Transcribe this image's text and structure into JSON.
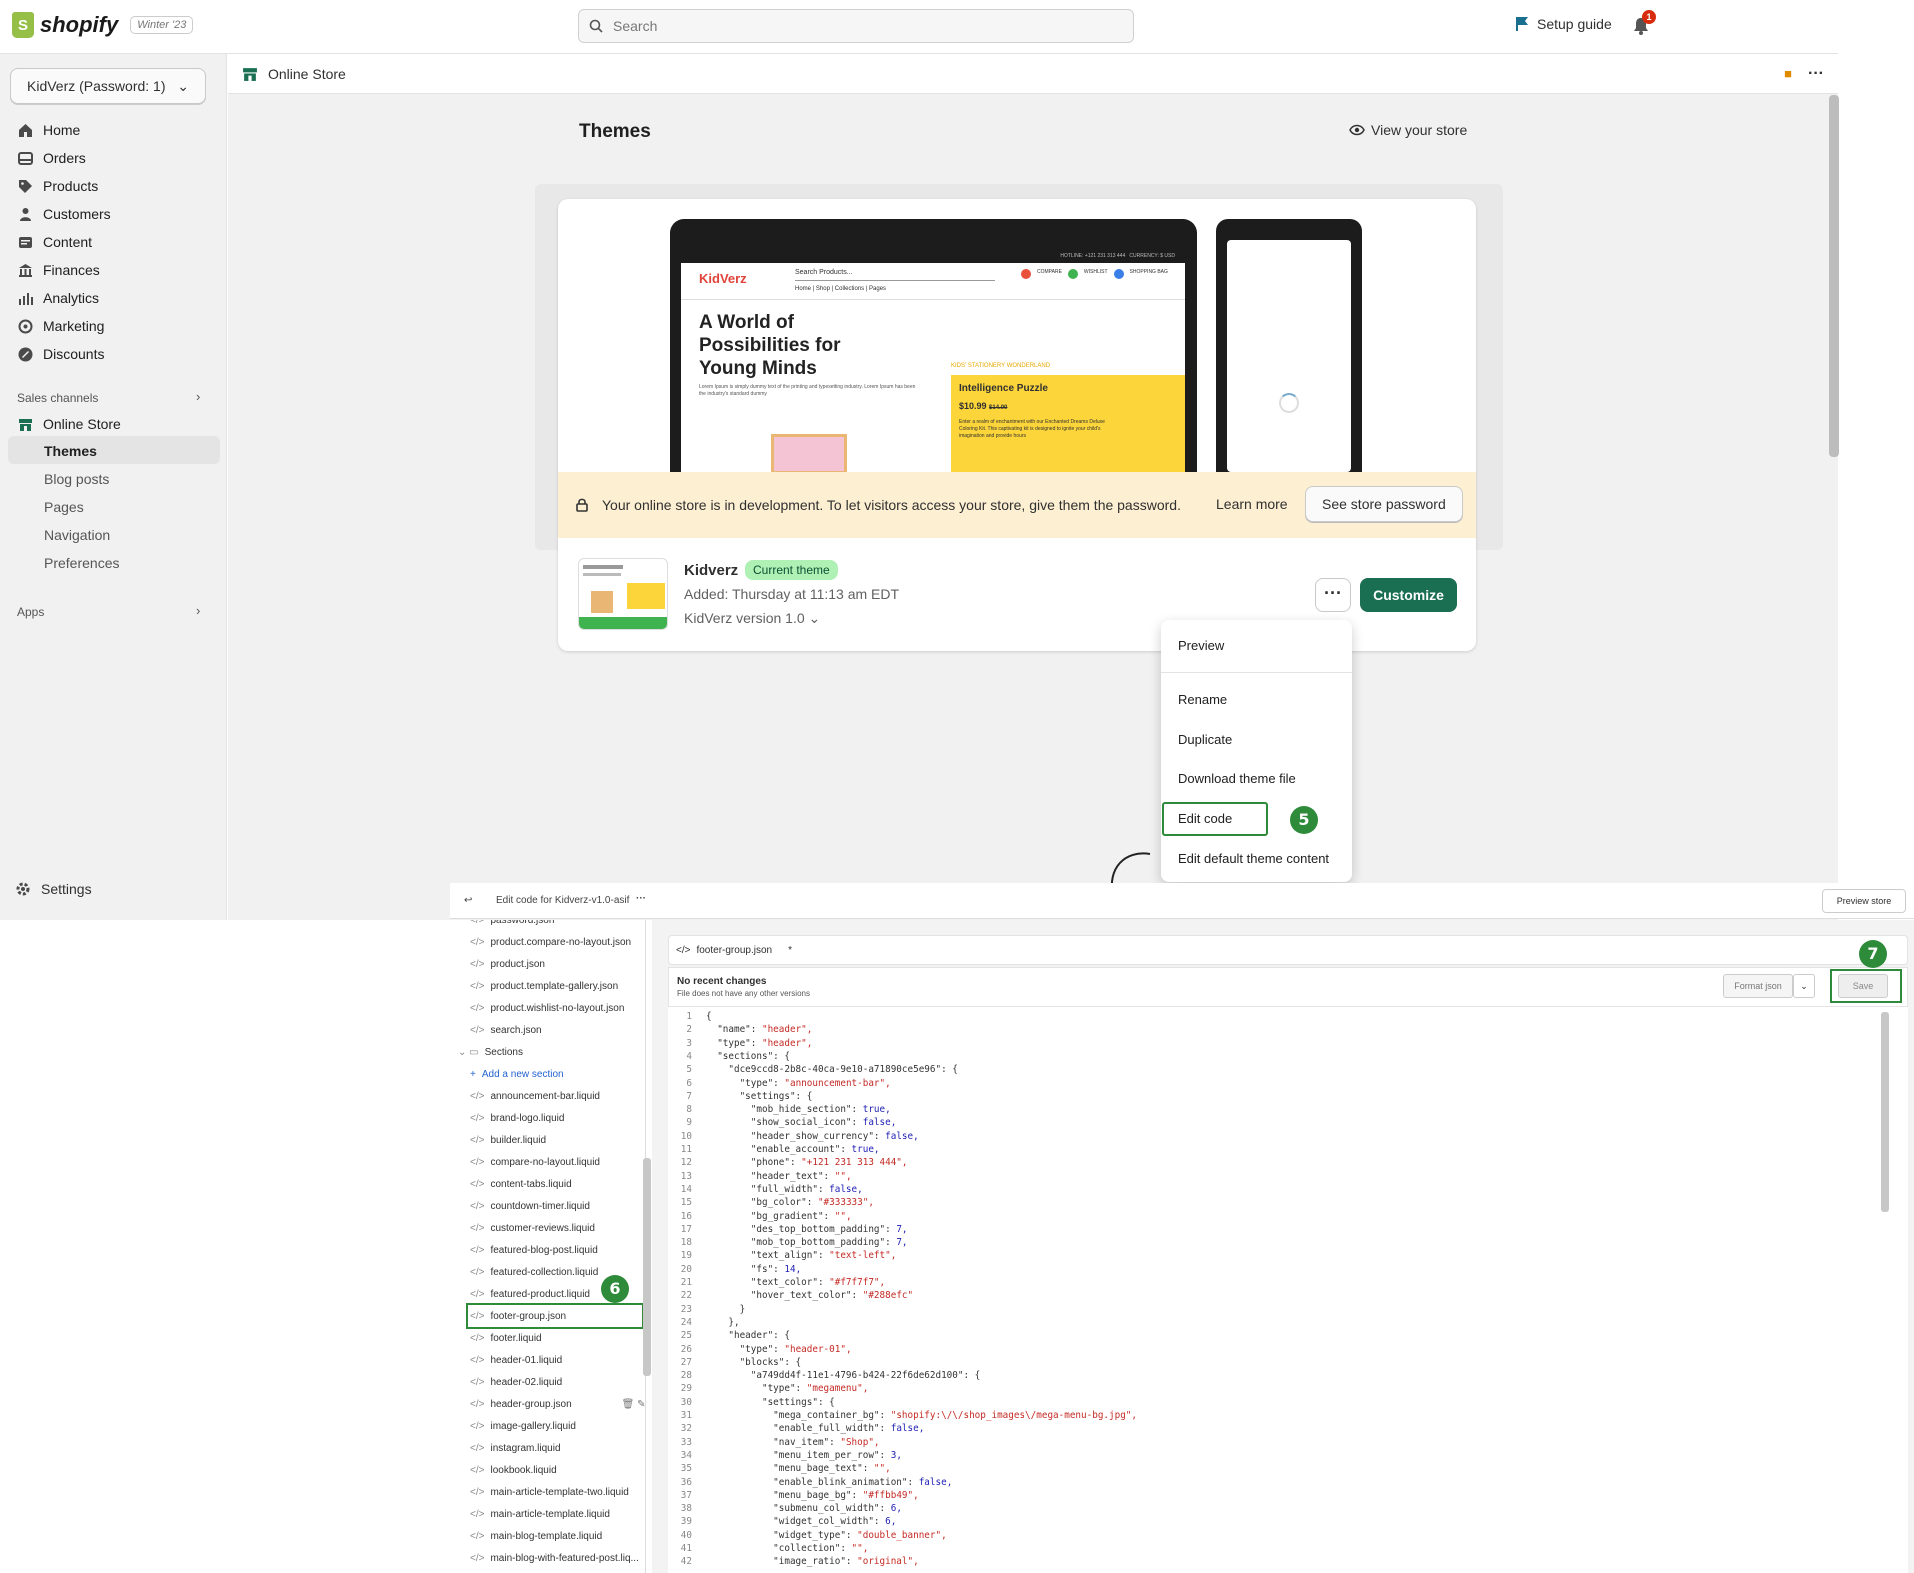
{
  "topbar": {
    "brand": "shopify",
    "edition": "Winter '23",
    "search_placeholder": "Search",
    "setup_guide": "Setup guide",
    "notifications": "1"
  },
  "sidebar": {
    "store": "KidVerz (Password: 1)",
    "items": [
      {
        "label": "Home",
        "icon": "home-icon"
      },
      {
        "label": "Orders",
        "icon": "orders-icon"
      },
      {
        "label": "Products",
        "icon": "tag-icon"
      },
      {
        "label": "Customers",
        "icon": "person-icon"
      },
      {
        "label": "Content",
        "icon": "content-icon"
      },
      {
        "label": "Finances",
        "icon": "bank-icon"
      },
      {
        "label": "Analytics",
        "icon": "bars-icon"
      },
      {
        "label": "Marketing",
        "icon": "target-icon"
      },
      {
        "label": "Discounts",
        "icon": "discount-icon"
      }
    ],
    "sales_channels": "Sales channels",
    "online_store": "Online Store",
    "sub": [
      "Themes",
      "Blog posts",
      "Pages",
      "Navigation",
      "Preferences"
    ],
    "apps": "Apps",
    "settings": "Settings"
  },
  "page": {
    "breadcrumb": "Online Store",
    "title": "Themes",
    "view_store": "View your store"
  },
  "preview": {
    "hotline": "HOTLINE: +121 231 313 444",
    "currency": "CURRENCY: $ USD",
    "brand": "KidVerz",
    "search": "Search Products...",
    "compare": "COMPARE",
    "wishlist": "WISHLIST",
    "shopping": "SHOPPING BAG",
    "nav": "Home | Shop | Collections | Pages",
    "headline": "A World of Possibilities for Young Minds",
    "lorem": "Lorem Ipsum is simply dummy text of the printing and typesetting industry. Lorem Ipsum has been the industry's standard dummy",
    "kicker": "KIDS' STATIONERY WONDERLAND",
    "product": "Intelligence Puzzle",
    "price": "$10.99",
    "old_price": "$14.00",
    "desc": "Enter a realm of enchantment with our Enchanted Dreams Deluxe Coloring Kit. This captivating kit is designed to ignite your child's imagination and provide hours"
  },
  "banner": {
    "text": "Your online store is in development. To let visitors access your store, give them the password.",
    "learn": "Learn more",
    "button": "See store password"
  },
  "theme": {
    "name": "Kidverz",
    "badge": "Current theme",
    "added": "Added: Thursday at 11:13 am EDT",
    "version": "KidVerz version 1.0",
    "more": "···",
    "customize": "Customize"
  },
  "menu": {
    "items": [
      "Preview",
      "Rename",
      "Duplicate",
      "Download theme file",
      "Edit code",
      "Edit default theme content"
    ]
  },
  "steps": [
    "5",
    "6",
    "7"
  ],
  "editor": {
    "title": "Edit code for Kidverz-v1.0-asif",
    "preview_store": "Preview store",
    "tab": "footer-group.json",
    "tab_mark": "*",
    "no_changes": "No recent changes",
    "no_versions": "File does not have any other versions",
    "format": "Format json",
    "save": "Save",
    "files": [
      "password.json",
      "product.compare-no-layout.json",
      "product.json",
      "product.template-gallery.json",
      "product.wishlist-no-layout.json",
      "search.json"
    ],
    "sections_label": "Sections",
    "add_section": "Add a new section",
    "sections": [
      "announcement-bar.liquid",
      "brand-logo.liquid",
      "builder.liquid",
      "compare-no-layout.liquid",
      "content-tabs.liquid",
      "countdown-timer.liquid",
      "customer-reviews.liquid",
      "featured-blog-post.liquid",
      "featured-collection.liquid",
      "featured-product.liquid",
      "footer-group.json",
      "footer.liquid",
      "header-01.liquid",
      "header-02.liquid",
      "header-group.json",
      "image-gallery.liquid",
      "instagram.liquid",
      "lookbook.liquid",
      "main-article-template-two.liquid",
      "main-article-template.liquid",
      "main-blog-template.liquid",
      "main-blog-with-featured-post.liq..."
    ],
    "code": [
      [
        "1",
        "{",
        ""
      ],
      [
        "2",
        "  \"name\": ",
        "\"header\","
      ],
      [
        "3",
        "  \"type\": ",
        "\"header\","
      ],
      [
        "4",
        "  \"sections\": {",
        ""
      ],
      [
        "5",
        "    \"dce9ccd8-2b8c-40ca-9e10-a71890ce5e96\": {",
        ""
      ],
      [
        "6",
        "      \"type\": ",
        "\"announcement-bar\","
      ],
      [
        "7",
        "      \"settings\": {",
        ""
      ],
      [
        "8",
        "        \"mob_hide_section\": ",
        "true,"
      ],
      [
        "9",
        "        \"show_social_icon\": ",
        "false,"
      ],
      [
        "10",
        "        \"header_show_currency\": ",
        "false,"
      ],
      [
        "11",
        "        \"enable_account\": ",
        "true,"
      ],
      [
        "12",
        "        \"phone\": ",
        "\"+121 231 313 444\","
      ],
      [
        "13",
        "        \"header_text\": ",
        "\"\","
      ],
      [
        "14",
        "        \"full_width\": ",
        "false,"
      ],
      [
        "15",
        "        \"bg_color\": ",
        "\"#333333\","
      ],
      [
        "16",
        "        \"bg_gradient\": ",
        "\"\","
      ],
      [
        "17",
        "        \"des_top_bottom_padding\": ",
        "7,"
      ],
      [
        "18",
        "        \"mob_top_bottom_padding\": ",
        "7,"
      ],
      [
        "19",
        "        \"text_align\": ",
        "\"text-left\","
      ],
      [
        "20",
        "        \"fs\": ",
        "14,"
      ],
      [
        "21",
        "        \"text_color\": ",
        "\"#f7f7f7\","
      ],
      [
        "22",
        "        \"hover_text_color\": ",
        "\"#288efc\""
      ],
      [
        "23",
        "      }",
        ""
      ],
      [
        "24",
        "    },",
        ""
      ],
      [
        "25",
        "    \"header\": {",
        ""
      ],
      [
        "26",
        "      \"type\": ",
        "\"header-01\","
      ],
      [
        "27",
        "      \"blocks\": {",
        ""
      ],
      [
        "28",
        "        \"a749dd4f-11e1-4796-b424-22f6de62d100\": {",
        ""
      ],
      [
        "29",
        "          \"type\": ",
        "\"megamenu\","
      ],
      [
        "30",
        "          \"settings\": {",
        ""
      ],
      [
        "31",
        "            \"mega_container_bg\": ",
        "\"shopify:\\/\\/shop_images\\/mega-menu-bg.jpg\","
      ],
      [
        "32",
        "            \"enable_full_width\": ",
        "false,"
      ],
      [
        "33",
        "            \"nav_item\": ",
        "\"Shop\","
      ],
      [
        "34",
        "            \"menu_item_per_row\": ",
        "3,"
      ],
      [
        "35",
        "            \"menu_bage_text\": ",
        "\"\","
      ],
      [
        "36",
        "            \"enable_blink_animation\": ",
        "false,"
      ],
      [
        "37",
        "            \"menu_bage_bg\": ",
        "\"#ffbb49\","
      ],
      [
        "38",
        "            \"submenu_col_width\": ",
        "6,"
      ],
      [
        "39",
        "            \"widget_col_width\": ",
        "6,"
      ],
      [
        "40",
        "            \"widget_type\": ",
        "\"double_banner\","
      ],
      [
        "41",
        "            \"collection\": ",
        "\"\","
      ],
      [
        "42",
        "            \"image_ratio\": ",
        "\"original\","
      ]
    ]
  },
  "colors": {
    "brand_green": "#1a6e52",
    "highlight": "#2e8b3a",
    "banner": "#fdefd2"
  }
}
